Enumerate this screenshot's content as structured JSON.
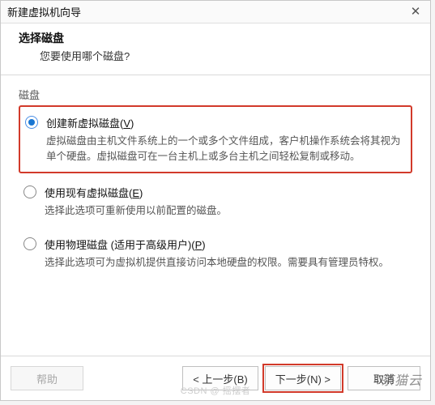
{
  "window": {
    "title": "新建虚拟机向导"
  },
  "header": {
    "title": "选择磁盘",
    "subtitle": "您要使用哪个磁盘?"
  },
  "group_label": "磁盘",
  "options": [
    {
      "label_pre": "创建新虚拟磁盘(",
      "hotkey": "V",
      "label_post": ")",
      "description": "虚拟磁盘由主机文件系统上的一个或多个文件组成，客户机操作系统会将其视为单个硬盘。虚拟磁盘可在一台主机上或多台主机之间轻松复制或移动。",
      "selected": true
    },
    {
      "label_pre": "使用现有虚拟磁盘(",
      "hotkey": "E",
      "label_post": ")",
      "description": "选择此选项可重新使用以前配置的磁盘。",
      "selected": false
    },
    {
      "label_pre": "使用物理磁盘 (适用于高级用户)(",
      "hotkey": "P",
      "label_post": ")",
      "description": "选择此选项可为虚拟机提供直接访问本地硬盘的权限。需要具有管理员特权。",
      "selected": false
    }
  ],
  "buttons": {
    "help": "帮助",
    "back": "< 上一步(B)",
    "next": "下一步(N) >",
    "cancel": "取消"
  },
  "watermark": "茶猫云",
  "csdn": "CSDN @ 摇摆者"
}
